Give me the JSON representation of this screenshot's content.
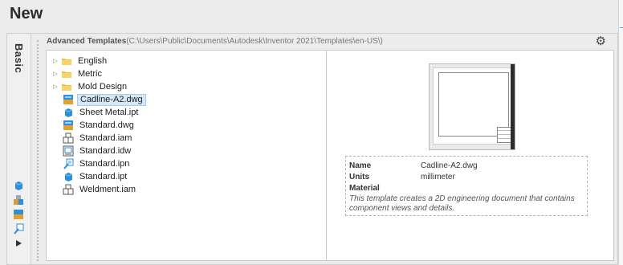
{
  "window": {
    "title": "New"
  },
  "tabs": {
    "basic_label": "Basic"
  },
  "templates": {
    "header_label": "Advanced Templates",
    "path": "(C:\\Users\\Public\\Documents\\Autodesk\\Inventor 2021\\Templates\\en-US\\)"
  },
  "tree": {
    "folders": [
      {
        "label": "English",
        "icon": "folder-icon"
      },
      {
        "label": "Metric",
        "icon": "folder-icon"
      },
      {
        "label": "Mold Design",
        "icon": "folder-icon"
      }
    ],
    "files": [
      {
        "label": "Cadline-A2.dwg",
        "icon": "dwg-file-icon",
        "selected": true
      },
      {
        "label": "Sheet Metal.ipt",
        "icon": "part-file-icon"
      },
      {
        "label": "Standard.dwg",
        "icon": "dwg-file-icon"
      },
      {
        "label": "Standard.iam",
        "icon": "assembly-file-icon"
      },
      {
        "label": "Standard.idw",
        "icon": "drawing-file-icon"
      },
      {
        "label": "Standard.ipn",
        "icon": "presentation-file-icon"
      },
      {
        "label": "Standard.ipt",
        "icon": "part-file-icon"
      },
      {
        "label": "Weldment.iam",
        "icon": "assembly-file-icon"
      }
    ]
  },
  "details": {
    "name_label": "Name",
    "name_value": "Cadline-A2.dwg",
    "units_label": "Units",
    "units_value": "millimeter",
    "material_label": "Material",
    "description": "This template creates a 2D engineering document that contains component views and details."
  },
  "colors": {
    "accent": "#5a9fd6",
    "selection": "#d6e8f7"
  }
}
